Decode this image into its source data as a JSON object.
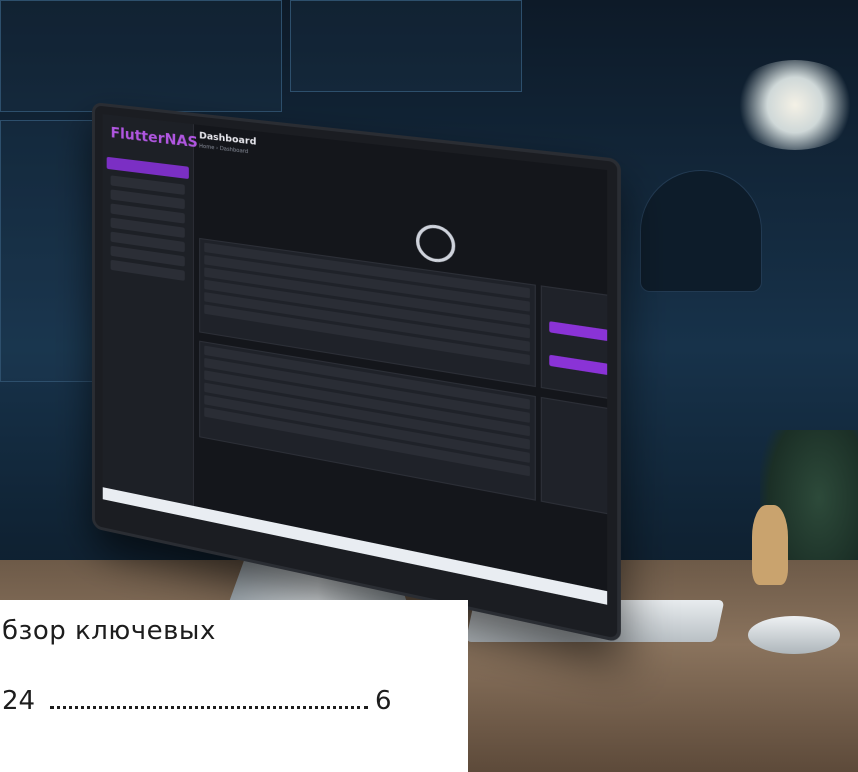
{
  "monitor": {
    "app_logo": "FlutterNAS",
    "page_title": "Dashboard",
    "breadcrumb": "Home › Dashboard"
  },
  "caption": {
    "line1": "бзор ключевых",
    "line2_start": "24",
    "line2_page": "6"
  },
  "colors": {
    "accent": "#8a33d6",
    "caption_bg": "#ffffff",
    "caption_text": "#1d1d1d"
  }
}
